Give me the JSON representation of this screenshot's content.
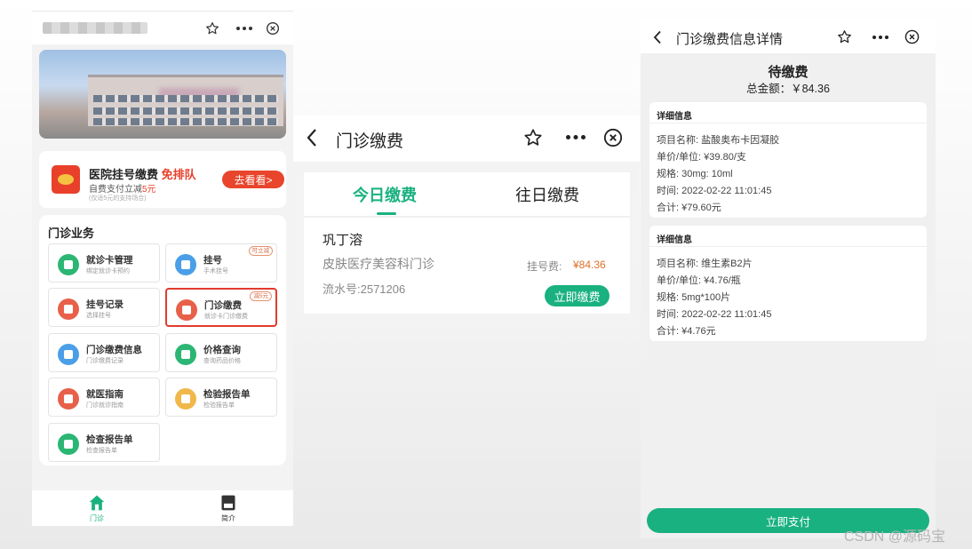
{
  "colors": {
    "accent_green": "#1ab180",
    "price_orange": "#e07028",
    "promo_red": "#e8402a"
  },
  "panel1": {
    "promo": {
      "title": "医院挂号缴费",
      "title_highlight": "免排队",
      "subtitle": "自费支付立减",
      "subtitle_highlight": "5元",
      "fine_print": "(仅适5元的支持场合)",
      "cta": "去看看>"
    },
    "section_title": "门诊业务",
    "services": [
      {
        "name": "就诊卡管理",
        "sub": "绑定就诊卡预约",
        "tag": "",
        "icon": "card-icon",
        "color": "#2bb673"
      },
      {
        "name": "挂号",
        "sub": "手术挂号",
        "tag": "可立减",
        "icon": "clock-icon",
        "color": "#4a9fe8"
      },
      {
        "name": "挂号记录",
        "sub": "选择挂号",
        "tag": "",
        "icon": "record-icon",
        "color": "#e8604a"
      },
      {
        "name": "门诊缴费",
        "sub": "就诊卡门诊缴费",
        "tag": "减5元",
        "icon": "wallet-icon",
        "color": "#e8604a"
      },
      {
        "name": "门诊缴费信息",
        "sub": "门诊缴费记录",
        "tag": "",
        "icon": "list-icon",
        "color": "#4a9fe8"
      },
      {
        "name": "价格查询",
        "sub": "查询药品价格",
        "tag": "",
        "icon": "price-icon",
        "color": "#2bb673"
      },
      {
        "name": "就医指南",
        "sub": "门诊就诊指南",
        "tag": "",
        "icon": "guide-icon",
        "color": "#e8604a"
      },
      {
        "name": "检验报告单",
        "sub": "检验报告单",
        "tag": "",
        "icon": "report-icon",
        "color": "#f0b84a"
      },
      {
        "name": "检查报告单",
        "sub": "检查报告单",
        "tag": "",
        "icon": "check-report-icon",
        "color": "#2bb673"
      }
    ],
    "tabbar": [
      {
        "label": "门诊",
        "icon": "home-icon"
      },
      {
        "label": "简介",
        "icon": "intro-icon"
      }
    ]
  },
  "panel2": {
    "title": "门诊缴费",
    "tabs": [
      "今日缴费",
      "往日缴费"
    ],
    "record": {
      "patient": "巩丁溶",
      "department": "皮肤医疗美容科门诊",
      "serial": "流水号:2571206",
      "fee_label": "挂号费:",
      "fee_value": "¥84.36",
      "pay_button": "立即缴费"
    }
  },
  "panel3": {
    "title": "门诊缴费信息详情",
    "status": "待缴费",
    "total": "总金额：￥84.36",
    "details": [
      {
        "header": "详细信息",
        "lines": [
          "项目名称:  盐酸奥布卡因凝胶",
          "单价/单位:  ¥39.80/支",
          "规格:  30mg:  10ml",
          "时间:  2022-02-22 11:01:45",
          "合计:  ¥79.60元"
        ]
      },
      {
        "header": "详细信息",
        "lines": [
          "项目名称:  维生素B2片",
          "单价/单位:  ¥4.76/瓶",
          "规格:  5mg*100片",
          "时间:  2022-02-22 11:01:45",
          "合计:  ¥4.76元"
        ]
      }
    ],
    "pay_button": "立即支付"
  },
  "watermark": "CSDN @源码宝"
}
